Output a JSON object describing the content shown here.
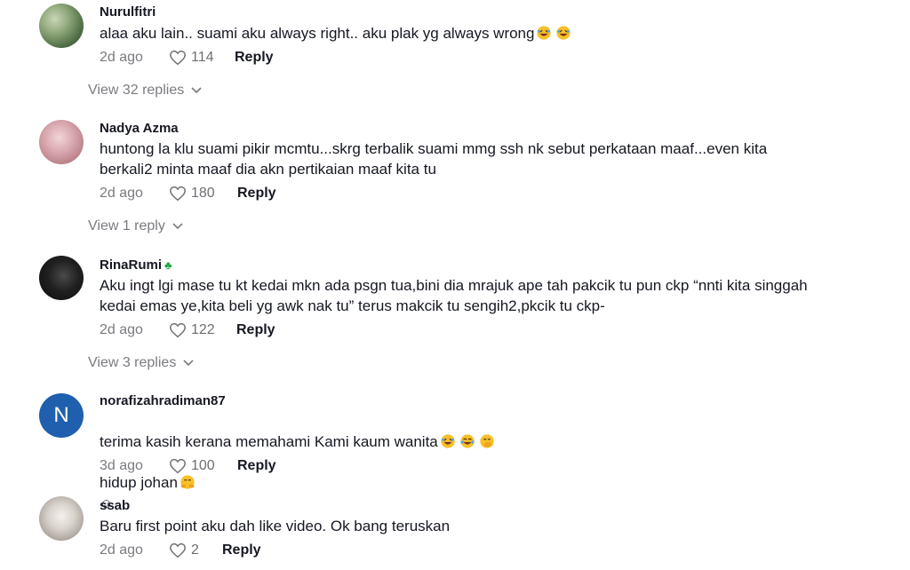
{
  "comments": [
    {
      "username": "Nurulfitri",
      "text": "alaa aku lain.. suami aku always right.. aku plak yg always wrong",
      "emojis": [
        "rolling-laughing-emoji",
        "rolling-laughing-emoji"
      ],
      "date": "2d ago",
      "likes": "114",
      "reply_label": "Reply",
      "view_replies": "View 32 replies"
    },
    {
      "username": "Nadya Azma",
      "text": "huntong la klu suami pikir mcmtu...skrg terbalik suami mmg ssh nk sebut perkataan maaf...even kita\nberkali2 minta maaf dia akn pertikaian maaf kita tu",
      "date": "2d ago",
      "likes": "180",
      "reply_label": "Reply",
      "view_replies": "View 1 reply"
    },
    {
      "username": "RinaRumi",
      "badge": "clover-icon",
      "text": "Aku ingt lgi mase tu kt kedai mkn ada psgn tua,bini dia mrajuk ape tah pakcik tu pun ckp “nnti kita singgah\nkedai emas ye,kita beli yg awk nak tu” terus makcik tu sengih2,pkcik tu ckp-",
      "date": "2d ago",
      "likes": "122",
      "reply_label": "Reply",
      "view_replies": "View 3 replies"
    },
    {
      "username": "norafizahradiman87",
      "avatar_letter": "N",
      "text_line1": "terima kasih kerana memahami Kami kaum wanita",
      "text_line2": "hidup johan",
      "text_line2_suffix": "☺",
      "date": "3d ago",
      "likes": "100",
      "reply_label": "Reply"
    },
    {
      "username": "ssab",
      "text": "Baru first point aku dah like video. Ok bang teruskan",
      "date": "2d ago",
      "likes": "2",
      "reply_label": "Reply"
    }
  ],
  "colors": {
    "text": "#161823",
    "muted": "#7a7b80",
    "badge_green": "#19a63a",
    "avatar_blue": "#1f5fae"
  }
}
